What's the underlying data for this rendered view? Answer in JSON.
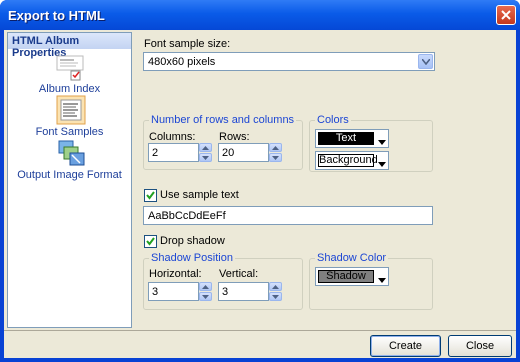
{
  "window": {
    "title": "Export to HTML"
  },
  "sidebar": {
    "header": "HTML Album Properties",
    "items": [
      {
        "label": "Album Index",
        "icon": "album-index-icon"
      },
      {
        "label": "Font Samples",
        "icon": "font-samples-icon",
        "selected": true
      },
      {
        "label": "Output Image Format",
        "icon": "output-format-icon"
      }
    ]
  },
  "font_size": {
    "label": "Font sample size:",
    "value": "480x60 pixels"
  },
  "rows_cols": {
    "title": "Number of rows and columns",
    "columns_label": "Columns:",
    "columns_value": "2",
    "rows_label": "Rows:",
    "rows_value": "20"
  },
  "colors": {
    "title": "Colors",
    "text_label": "Text",
    "text_color": "#000000",
    "background_label": "Background",
    "background_color": "#ffffff"
  },
  "use_sample": {
    "label": "Use sample text",
    "checked": true,
    "value": "AaBbCcDdEeFf"
  },
  "drop_shadow": {
    "label": "Drop shadow",
    "checked": true
  },
  "shadow_position": {
    "title": "Shadow Position",
    "horizontal_label": "Horizontal:",
    "horizontal_value": "3",
    "vertical_label": "Vertical:",
    "vertical_value": "3"
  },
  "shadow_color": {
    "title": "Shadow Color",
    "label": "Shadow",
    "color": "#808080"
  },
  "buttons": {
    "create": "Create",
    "close": "Close"
  }
}
